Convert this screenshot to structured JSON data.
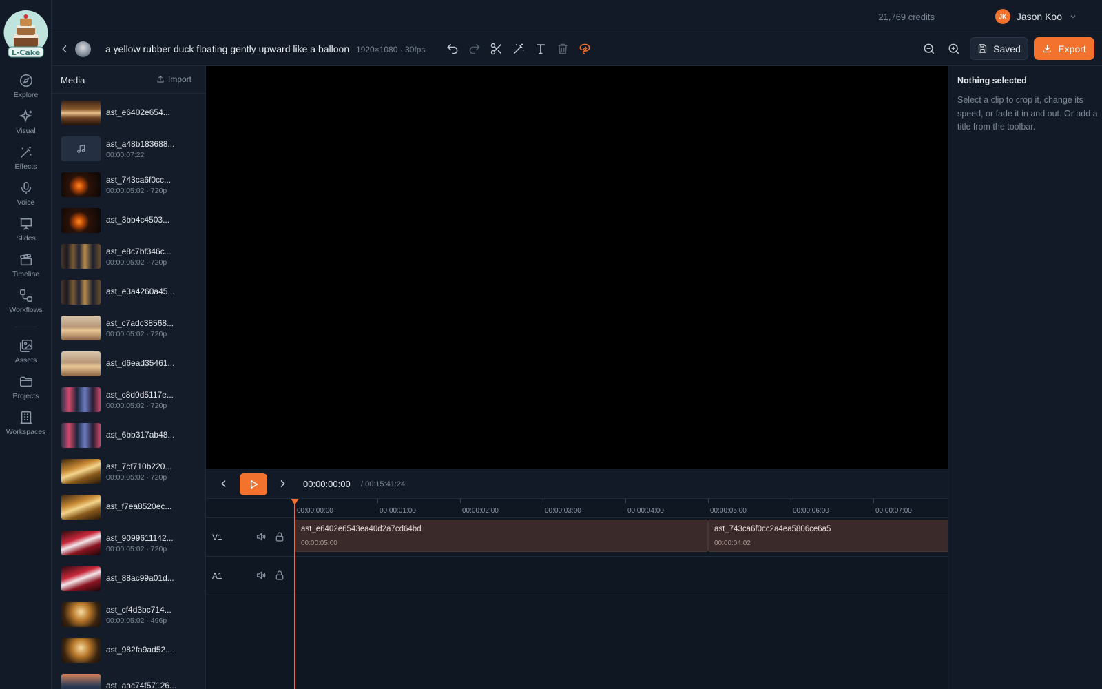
{
  "brand": {
    "logo_text": "L-Cake"
  },
  "nav": {
    "items": [
      {
        "label": "Explore",
        "icon": "compass-icon"
      },
      {
        "label": "Visual",
        "icon": "sparkles-icon"
      },
      {
        "label": "Effects",
        "icon": "magic-wand-icon"
      },
      {
        "label": "Voice",
        "icon": "microphone-icon"
      },
      {
        "label": "Slides",
        "icon": "presentation-icon"
      },
      {
        "label": "Timeline",
        "icon": "clapperboard-icon"
      },
      {
        "label": "Workflows",
        "icon": "workflow-icon"
      },
      {
        "label": "Assets",
        "icon": "images-icon"
      },
      {
        "label": "Projects",
        "icon": "folder-icon"
      },
      {
        "label": "Workspaces",
        "icon": "building-icon"
      }
    ]
  },
  "topbar": {
    "credits": "21,769 credits",
    "user": {
      "initials": "JK",
      "name": "Jason Koo"
    }
  },
  "project": {
    "title": "a yellow rubber duck floating gently upward like a balloon",
    "meta": "1920×1080 · 30fps"
  },
  "toolbar": {
    "tools": [
      "undo-icon",
      "redo-icon",
      "scissors-icon",
      "magic-wand-icon",
      "text-icon",
      "trash-icon",
      "lasso-icon"
    ],
    "saved_label": "Saved",
    "export_label": "Export"
  },
  "media": {
    "title": "Media",
    "import_label": "Import",
    "items": [
      {
        "name": "ast_e6402e654...",
        "sub": ""
      },
      {
        "name": "ast_a48b183688...",
        "sub": "00:00:07:22"
      },
      {
        "name": "ast_743ca6f0cc...",
        "sub": "00:00:05:02 · 720p"
      },
      {
        "name": "ast_3bb4c4503...",
        "sub": ""
      },
      {
        "name": "ast_e8c7bf346c...",
        "sub": "00:00:05:02 · 720p"
      },
      {
        "name": "ast_e3a4260a45...",
        "sub": ""
      },
      {
        "name": "ast_c7adc38568...",
        "sub": "00:00:05:02 · 720p"
      },
      {
        "name": "ast_d6ead35461...",
        "sub": ""
      },
      {
        "name": "ast_c8d0d5117e...",
        "sub": "00:00:05:02 · 720p"
      },
      {
        "name": "ast_6bb317ab48...",
        "sub": ""
      },
      {
        "name": "ast_7cf710b220...",
        "sub": "00:00:05:02 · 720p"
      },
      {
        "name": "ast_f7ea8520ec...",
        "sub": ""
      },
      {
        "name": "ast_9099611142...",
        "sub": "00:00:05:02 · 720p"
      },
      {
        "name": "ast_88ac99a01d...",
        "sub": ""
      },
      {
        "name": "ast_cf4d3bc714...",
        "sub": "00:00:05:02 · 496p"
      },
      {
        "name": "ast_982fa9ad52...",
        "sub": ""
      },
      {
        "name": "ast_aac74f57126...",
        "sub": ""
      }
    ]
  },
  "inspector": {
    "title": "Nothing selected",
    "text": "Select a clip to crop it, change its speed, or fade it in and out. Or add a title from the toolbar."
  },
  "transport": {
    "current": "00:00:00:00",
    "total": "/ 00:15:41:24"
  },
  "timeline": {
    "ruler": [
      "00:00:00:00",
      "00:00:01:00",
      "00:00:02:00",
      "00:00:03:00",
      "00:00:04:00",
      "00:00:05:00",
      "00:00:06:00",
      "00:00:07:00"
    ],
    "tracks": [
      {
        "label": "V1",
        "clips": [
          {
            "name": "ast_e6402e6543ea40d2a7cd64bd",
            "duration": "00:00:05:00"
          },
          {
            "name": "ast_743ca6f0cc2a4ea5806ce6a5",
            "duration": "00:00:04:02"
          }
        ]
      },
      {
        "label": "A1",
        "clips": []
      }
    ]
  }
}
